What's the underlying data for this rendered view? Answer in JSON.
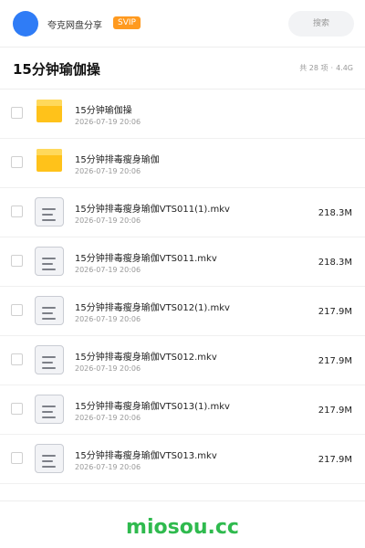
{
  "header": {
    "share_name": "夸克网盘分享",
    "badge": "SVIP",
    "search_label": "搜索",
    "avatar_color": "#2f7cf6",
    "badge_color": "#ff9a1f"
  },
  "title_bar": {
    "title": "15分钟瑜伽操",
    "count": "共 28 项",
    "separator": "·",
    "size": "4.4G"
  },
  "files": [
    {
      "type": "folder",
      "icon": "folder-icon",
      "name": "15分钟瑜伽操",
      "date": "2026-07-19 20:06",
      "size": ""
    },
    {
      "type": "folder",
      "icon": "folder-icon",
      "name": "15分钟排毒瘦身瑜伽",
      "date": "2026-07-19 20:06",
      "size": ""
    },
    {
      "type": "file",
      "icon": "document-icon",
      "name": "15分钟排毒瘦身瑜伽VTS011(1).mkv",
      "date": "2026-07-19 20:06",
      "size": "218.3M"
    },
    {
      "type": "file",
      "icon": "document-icon",
      "name": "15分钟排毒瘦身瑜伽VTS011.mkv",
      "date": "2026-07-19 20:06",
      "size": "218.3M"
    },
    {
      "type": "file",
      "icon": "document-icon",
      "name": "15分钟排毒瘦身瑜伽VTS012(1).mkv",
      "date": "2026-07-19 20:06",
      "size": "217.9M"
    },
    {
      "type": "file",
      "icon": "document-icon",
      "name": "15分钟排毒瘦身瑜伽VTS012.mkv",
      "date": "2026-07-19 20:06",
      "size": "217.9M"
    },
    {
      "type": "file",
      "icon": "document-icon",
      "name": "15分钟排毒瘦身瑜伽VTS013(1).mkv",
      "date": "2026-07-19 20:06",
      "size": "217.9M"
    },
    {
      "type": "file",
      "icon": "document-icon",
      "name": "15分钟排毒瘦身瑜伽VTS013.mkv",
      "date": "2026-07-19 20:06",
      "size": "217.9M"
    }
  ],
  "footer": {
    "watermark": "miosou.cc",
    "watermark_color": "#2fba4e"
  }
}
